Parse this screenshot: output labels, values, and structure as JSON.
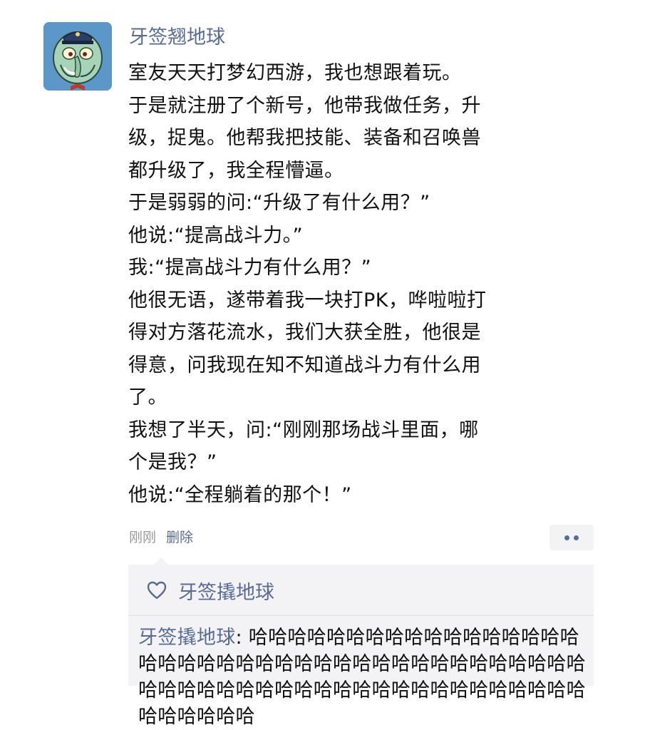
{
  "post": {
    "author": "牙签翘地球",
    "avatar_icon": "squidward-cartoon-avatar",
    "lines": [
      "室友天天打梦幻西游，我也想跟着玩。",
      "于是就注册了个新号，他带我做任务，升",
      "级，捉鬼。他帮我把技能、装备和召唤兽",
      "都升级了，我全程懵逼。",
      "于是弱弱的问:“升级了有什么用？”",
      "他说:“提高战斗力。”",
      "我:“提高战斗力有什么用？”",
      "他很无语，遂带着我一块打PK，哗啦啦打",
      "得对方落花流水，我们大获全胜，他很是",
      "得意，问我现在知不知道战斗力有什么用",
      "了。",
      "我想了半天，问:“刚刚那场战斗里面，哪",
      "个是我？”",
      "他说:“全程躺着的那个！”"
    ],
    "time": "刚刚",
    "delete_label": "删除",
    "more_icon": "more-dots-icon"
  },
  "interactions": {
    "like_icon": "heart-icon",
    "likes": "牙签撬地球",
    "comments": [
      {
        "author": "牙签撬地球",
        "separator": ": ",
        "text": "哈哈哈哈哈哈哈哈哈哈哈哈哈哈哈哈哈哈哈哈哈哈哈哈哈哈哈哈哈哈哈哈哈哈哈哈哈哈哈哈哈哈哈哈哈哈哈哈哈哈哈哈哈哈哈哈哈哈哈哈哈哈哈哈哈哈哈哈哈"
      }
    ]
  },
  "colors": {
    "link_blue": "#576b95",
    "text": "#111111",
    "meta_gray": "#9a9a9a",
    "panel_bg": "#f3f3f5"
  }
}
